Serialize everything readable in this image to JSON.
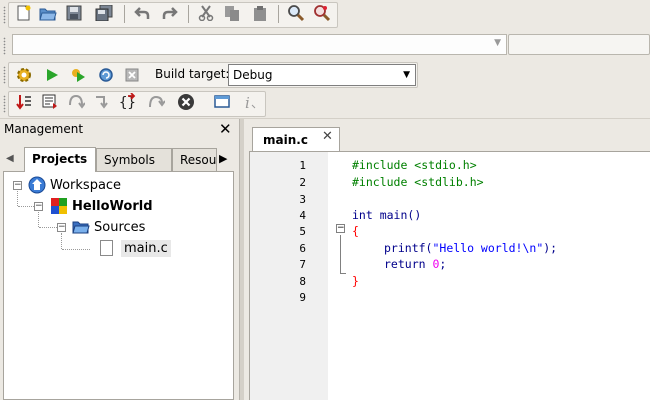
{
  "build_toolbar": {
    "build_target_label": "Build target:",
    "build_target_value": "Debug"
  },
  "management": {
    "title": "Management",
    "close_glyph": "✕",
    "tabs": [
      {
        "label": "Projects",
        "active": true
      },
      {
        "label": "Symbols",
        "active": false
      },
      {
        "label": "Resou",
        "active": false
      }
    ],
    "tree": {
      "workspace": "Workspace",
      "project": "HelloWorld",
      "folder": "Sources",
      "file": "main.c"
    }
  },
  "editor": {
    "tab_label": "main.c",
    "tab_close_glyph": "✕",
    "line_numbers": [
      "1",
      "2",
      "3",
      "4",
      "5",
      "6",
      "7",
      "8",
      "9"
    ],
    "lines": {
      "l1": "#include <stdio.h>",
      "l2": "#include <stdlib.h>",
      "l4_kw": "int",
      "l4_rest": " main()",
      "l5": "{",
      "l6_fn": "printf(",
      "l6_str": "\"Hello world!\\n\"",
      "l6_end": ");",
      "l7_kw": "return",
      "l7_num": "0",
      "l7_end": ";",
      "l8": "}"
    }
  },
  "icons": {
    "toolbar1": [
      "new-file-icon",
      "open-icon",
      "save-icon",
      "save-all-icon",
      "undo-icon",
      "redo-icon",
      "cut-icon",
      "copy-icon",
      "paste-icon",
      "find-icon",
      "replace-icon"
    ],
    "toolbar3": [
      "build-gear-icon",
      "run-icon",
      "build-and-run-icon",
      "rebuild-icon",
      "abort-icon"
    ],
    "toolbar4": [
      "debug-start-icon",
      "run-to-cursor-icon",
      "next-line-icon",
      "step-into-icon",
      "step-out-icon",
      "next-instruction-icon",
      "stop-debug-icon",
      "debug-window-icon",
      "info-icon"
    ]
  },
  "colors": {
    "preprocessor": "#008000",
    "keyword": "#00008b",
    "string": "#0000ff",
    "number": "#f000f0",
    "brace": "#ff0000"
  }
}
